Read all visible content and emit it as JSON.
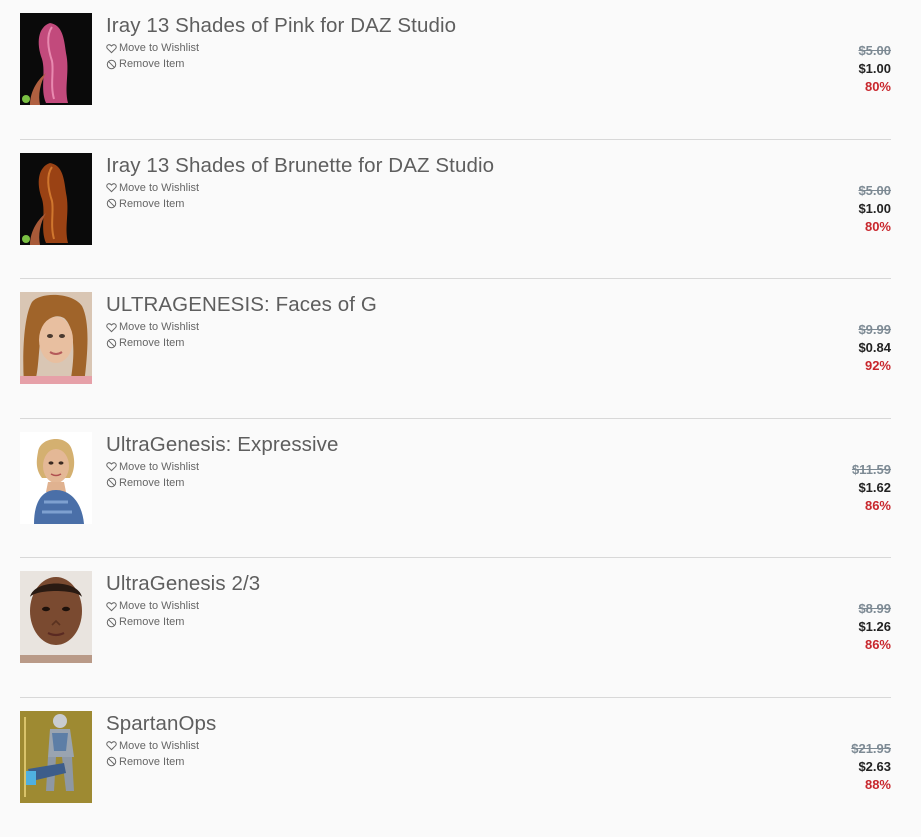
{
  "items": [
    {
      "title": "Iray 13 Shades of Pink for DAZ Studio",
      "wishlist_label": "Move to Wishlist",
      "remove_label": "Remove Item",
      "old_price": "$5.00",
      "price": "$1.00",
      "discount": "80%"
    },
    {
      "title": "Iray 13 Shades of Brunette for DAZ Studio",
      "wishlist_label": "Move to Wishlist",
      "remove_label": "Remove Item",
      "old_price": "$5.00",
      "price": "$1.00",
      "discount": "80%"
    },
    {
      "title": "ULTRAGENESIS: Faces of G",
      "wishlist_label": "Move to Wishlist",
      "remove_label": "Remove Item",
      "old_price": "$9.99",
      "price": "$0.84",
      "discount": "92%"
    },
    {
      "title": "UltraGenesis: Expressive",
      "wishlist_label": "Move to Wishlist",
      "remove_label": "Remove Item",
      "old_price": "$11.59",
      "price": "$1.62",
      "discount": "86%"
    },
    {
      "title": "UltraGenesis 2/3",
      "wishlist_label": "Move to Wishlist",
      "remove_label": "Remove Item",
      "old_price": "$8.99",
      "price": "$1.26",
      "discount": "86%"
    },
    {
      "title": "SpartanOps",
      "wishlist_label": "Move to Wishlist",
      "remove_label": "Remove Item",
      "old_price": "$21.95",
      "price": "$2.63",
      "discount": "88%"
    }
  ],
  "icons": {
    "wishlist": "heart-icon",
    "remove": "prohibited-icon"
  },
  "colors": {
    "discount": "#c8262c",
    "old_price": "#7d8a94",
    "divider": "#d8d8d8",
    "title": "#5e5e5e"
  }
}
